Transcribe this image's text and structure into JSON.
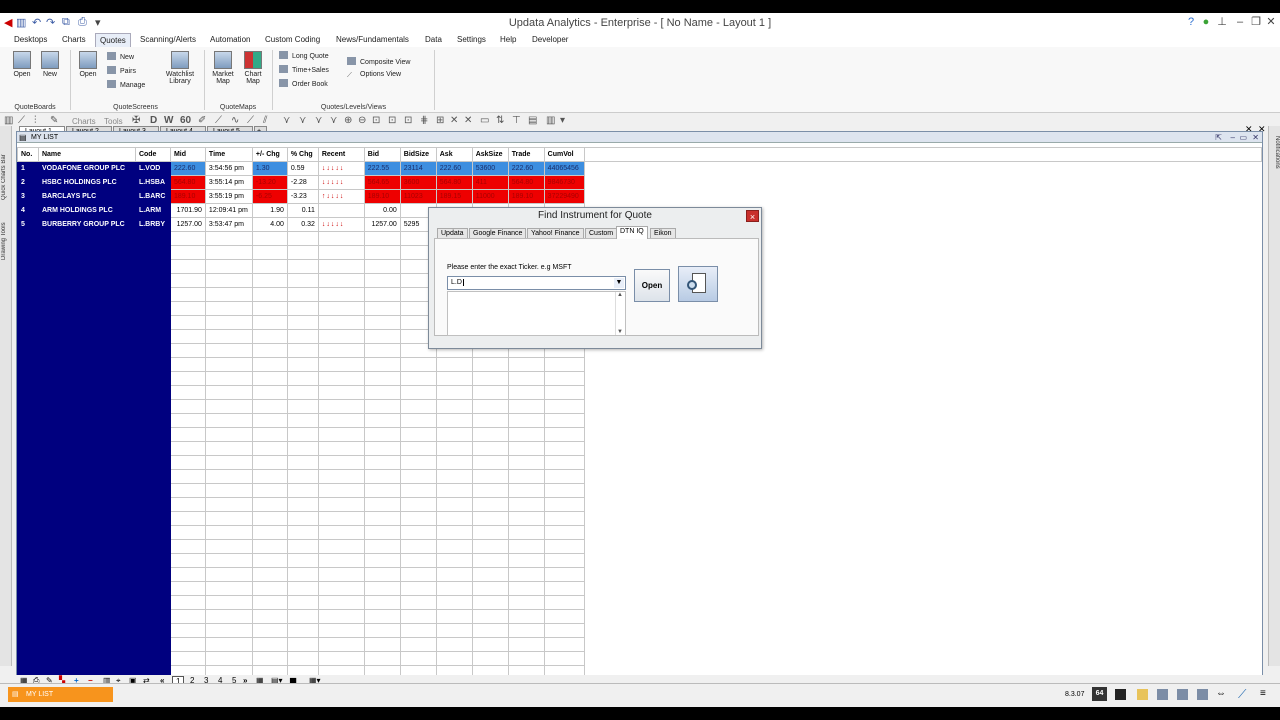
{
  "window": {
    "title": "Updata Analytics - Enterprise - [ No Name - Layout 1 ]"
  },
  "menu": [
    "Desktops",
    "Charts",
    "Quotes",
    "Scanning/Alerts",
    "Automation",
    "Custom Coding",
    "News/Fundamentals",
    "Data",
    "Settings",
    "Help",
    "Developer"
  ],
  "active_menu": "Quotes",
  "ribbon": {
    "quoteboards": {
      "open": "Open",
      "new": "New",
      "label": "QuoteBoards"
    },
    "quotescreens": {
      "open": "Open",
      "new": "New",
      "pairs": "Pairs",
      "manage": "Manage",
      "watchlist": "Watchlist Library",
      "label": "QuoteScreens"
    },
    "quotemaps": {
      "market_map": "Market Map",
      "chart_map": "Chart Map",
      "label": "QuoteMaps"
    },
    "levels": {
      "long_quote": "Long Quote",
      "time_sales": "Time+Sales",
      "order_book": "Order Book",
      "composite": "Composite View",
      "options": "Options View",
      "label": "Quotes/Levels/Views"
    }
  },
  "toolbar": {
    "charts": "Charts",
    "tools": "Tools",
    "d": "D",
    "w": "W",
    "sixty": "60"
  },
  "layouts": [
    "Layout 1",
    "Layout 2",
    "Layout 3",
    "Layout 4",
    "Layout 5"
  ],
  "left_tabs": [
    "Quick Charts Bar",
    "Drawing Tools"
  ],
  "right_tabs": [
    "Notifications"
  ],
  "list_title": "MY LIST",
  "columns": [
    "No.",
    "Name",
    "Code",
    "Mid",
    "Time",
    "+/- Chg",
    "% Chg",
    "Recent",
    "Bid",
    "BidSize",
    "Ask",
    "AskSize",
    "Trade",
    "CumVol"
  ],
  "rows": [
    {
      "no": "1",
      "name": "VODAFONE GROUP PLC",
      "code": "L.VOD",
      "mid": "222.60",
      "time": "3:54:56 pm",
      "chg": "1.30",
      "pct": "0.59",
      "recent": "↓↓↓↓↓",
      "bid": "222.55",
      "bidsize": "23114",
      "ask": "222.60",
      "asksize": "53600",
      "trade": "222.60",
      "cumvol": "44065456",
      "tone": "up"
    },
    {
      "no": "2",
      "name": "HSBC HOLDINGS PLC",
      "code": "L.HSBA",
      "mid": "564.80",
      "time": "3:55:14 pm",
      "chg": "-13.20",
      "pct": "-2.28",
      "recent": "↓↓↓↓↓",
      "bid": "564.65",
      "bidsize": "3600",
      "ask": "564.80",
      "asksize": "411",
      "trade": "564.80",
      "cumvol": "9846730",
      "tone": "dn"
    },
    {
      "no": "3",
      "name": "BARCLAYS PLC",
      "code": "L.BARC",
      "mid": "189.10",
      "time": "3:55:19 pm",
      "chg": "-6.25",
      "pct": "-3.23",
      "recent": "↑↓↓↓↓",
      "bid": "189.10",
      "bidsize": "11023",
      "ask": "189.15",
      "asksize": "11000",
      "trade": "189.10",
      "cumvol": "37229490",
      "tone": "dn"
    },
    {
      "no": "4",
      "name": "ARM HOLDINGS PLC",
      "code": "L.ARM",
      "mid": "1701.90",
      "time": "12:09:41 pm",
      "chg": "1.90",
      "pct": "0.11",
      "recent": "",
      "bid": "0.00",
      "bidsize": "",
      "ask": "",
      "asksize": "",
      "trade": "",
      "cumvol": "",
      "tone": "none"
    },
    {
      "no": "5",
      "name": "BURBERRY GROUP PLC",
      "code": "L.BRBY",
      "mid": "1257.00",
      "time": "3:53:47 pm",
      "chg": "4.00",
      "pct": "0.32",
      "recent": "↓↓↓↓↓",
      "bid": "1257.00",
      "bidsize": "5295",
      "ask": "",
      "asksize": "",
      "trade": "",
      "cumvol": "",
      "tone": "none"
    }
  ],
  "pager": {
    "prev": "«",
    "pages": [
      "1",
      "2",
      "3",
      "4",
      "5"
    ],
    "next": "»"
  },
  "status": {
    "tab": "MY LIST",
    "version": "8.3.07",
    "bits": "64"
  },
  "dialog": {
    "title": "Find Instrument for Quote",
    "close": "×",
    "tabs": [
      "Updata",
      "Google Finance",
      "Yahoo! Finance",
      "Custom",
      "DTN IQ",
      "Eikon"
    ],
    "active_tab": "DTN IQ",
    "prompt": "Please enter the exact Ticker. e.g MSFT",
    "ticker_value": "L.D",
    "open_label": "Open"
  },
  "colors": {
    "up": "#3d8ee0",
    "down": "#e00000",
    "list_blue": "#00007f",
    "status_orange": "#f7941d"
  }
}
